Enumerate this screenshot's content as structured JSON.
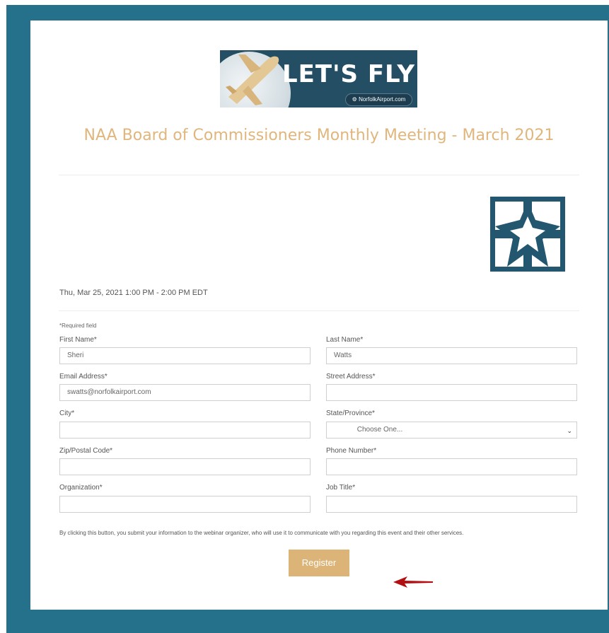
{
  "banner": {
    "title": "LET'S FLY",
    "site": "NorfolkAirport.com"
  },
  "event": {
    "title": "NAA Board of Commissioners Monthly Meeting - March 2021",
    "datetime": "Thu, Mar 25, 2021 1:00 PM - 2:00 PM EDT"
  },
  "form": {
    "required_note": "*Required field",
    "first_name": {
      "label": "First Name*",
      "value": "Sheri"
    },
    "last_name": {
      "label": "Last Name*",
      "value": "Watts"
    },
    "email": {
      "label": "Email Address*",
      "value": "swatts@norfolkairport.com"
    },
    "street": {
      "label": "Street Address*",
      "value": ""
    },
    "city": {
      "label": "City*",
      "value": ""
    },
    "state": {
      "label": "State/Province*",
      "value": "Choose One..."
    },
    "zip": {
      "label": "Zip/Postal Code*",
      "value": ""
    },
    "phone": {
      "label": "Phone Number*",
      "value": ""
    },
    "organization": {
      "label": "Organization*",
      "value": ""
    },
    "job_title": {
      "label": "Job Title*",
      "value": ""
    },
    "disclaimer": "By clicking this button, you submit your information to the webinar organizer, who will use it to communicate with you regarding this event and their other services.",
    "register_label": "Register"
  },
  "colors": {
    "frame": "#25708a",
    "accent": "#ddb477",
    "title": "#e0b67d",
    "logo": "#23566f",
    "arrow": "#b10f12"
  },
  "icons": [
    "airplane-icon",
    "gear-icon",
    "logo-star-icon",
    "chevron-down-icon",
    "red-arrow-icon"
  ]
}
